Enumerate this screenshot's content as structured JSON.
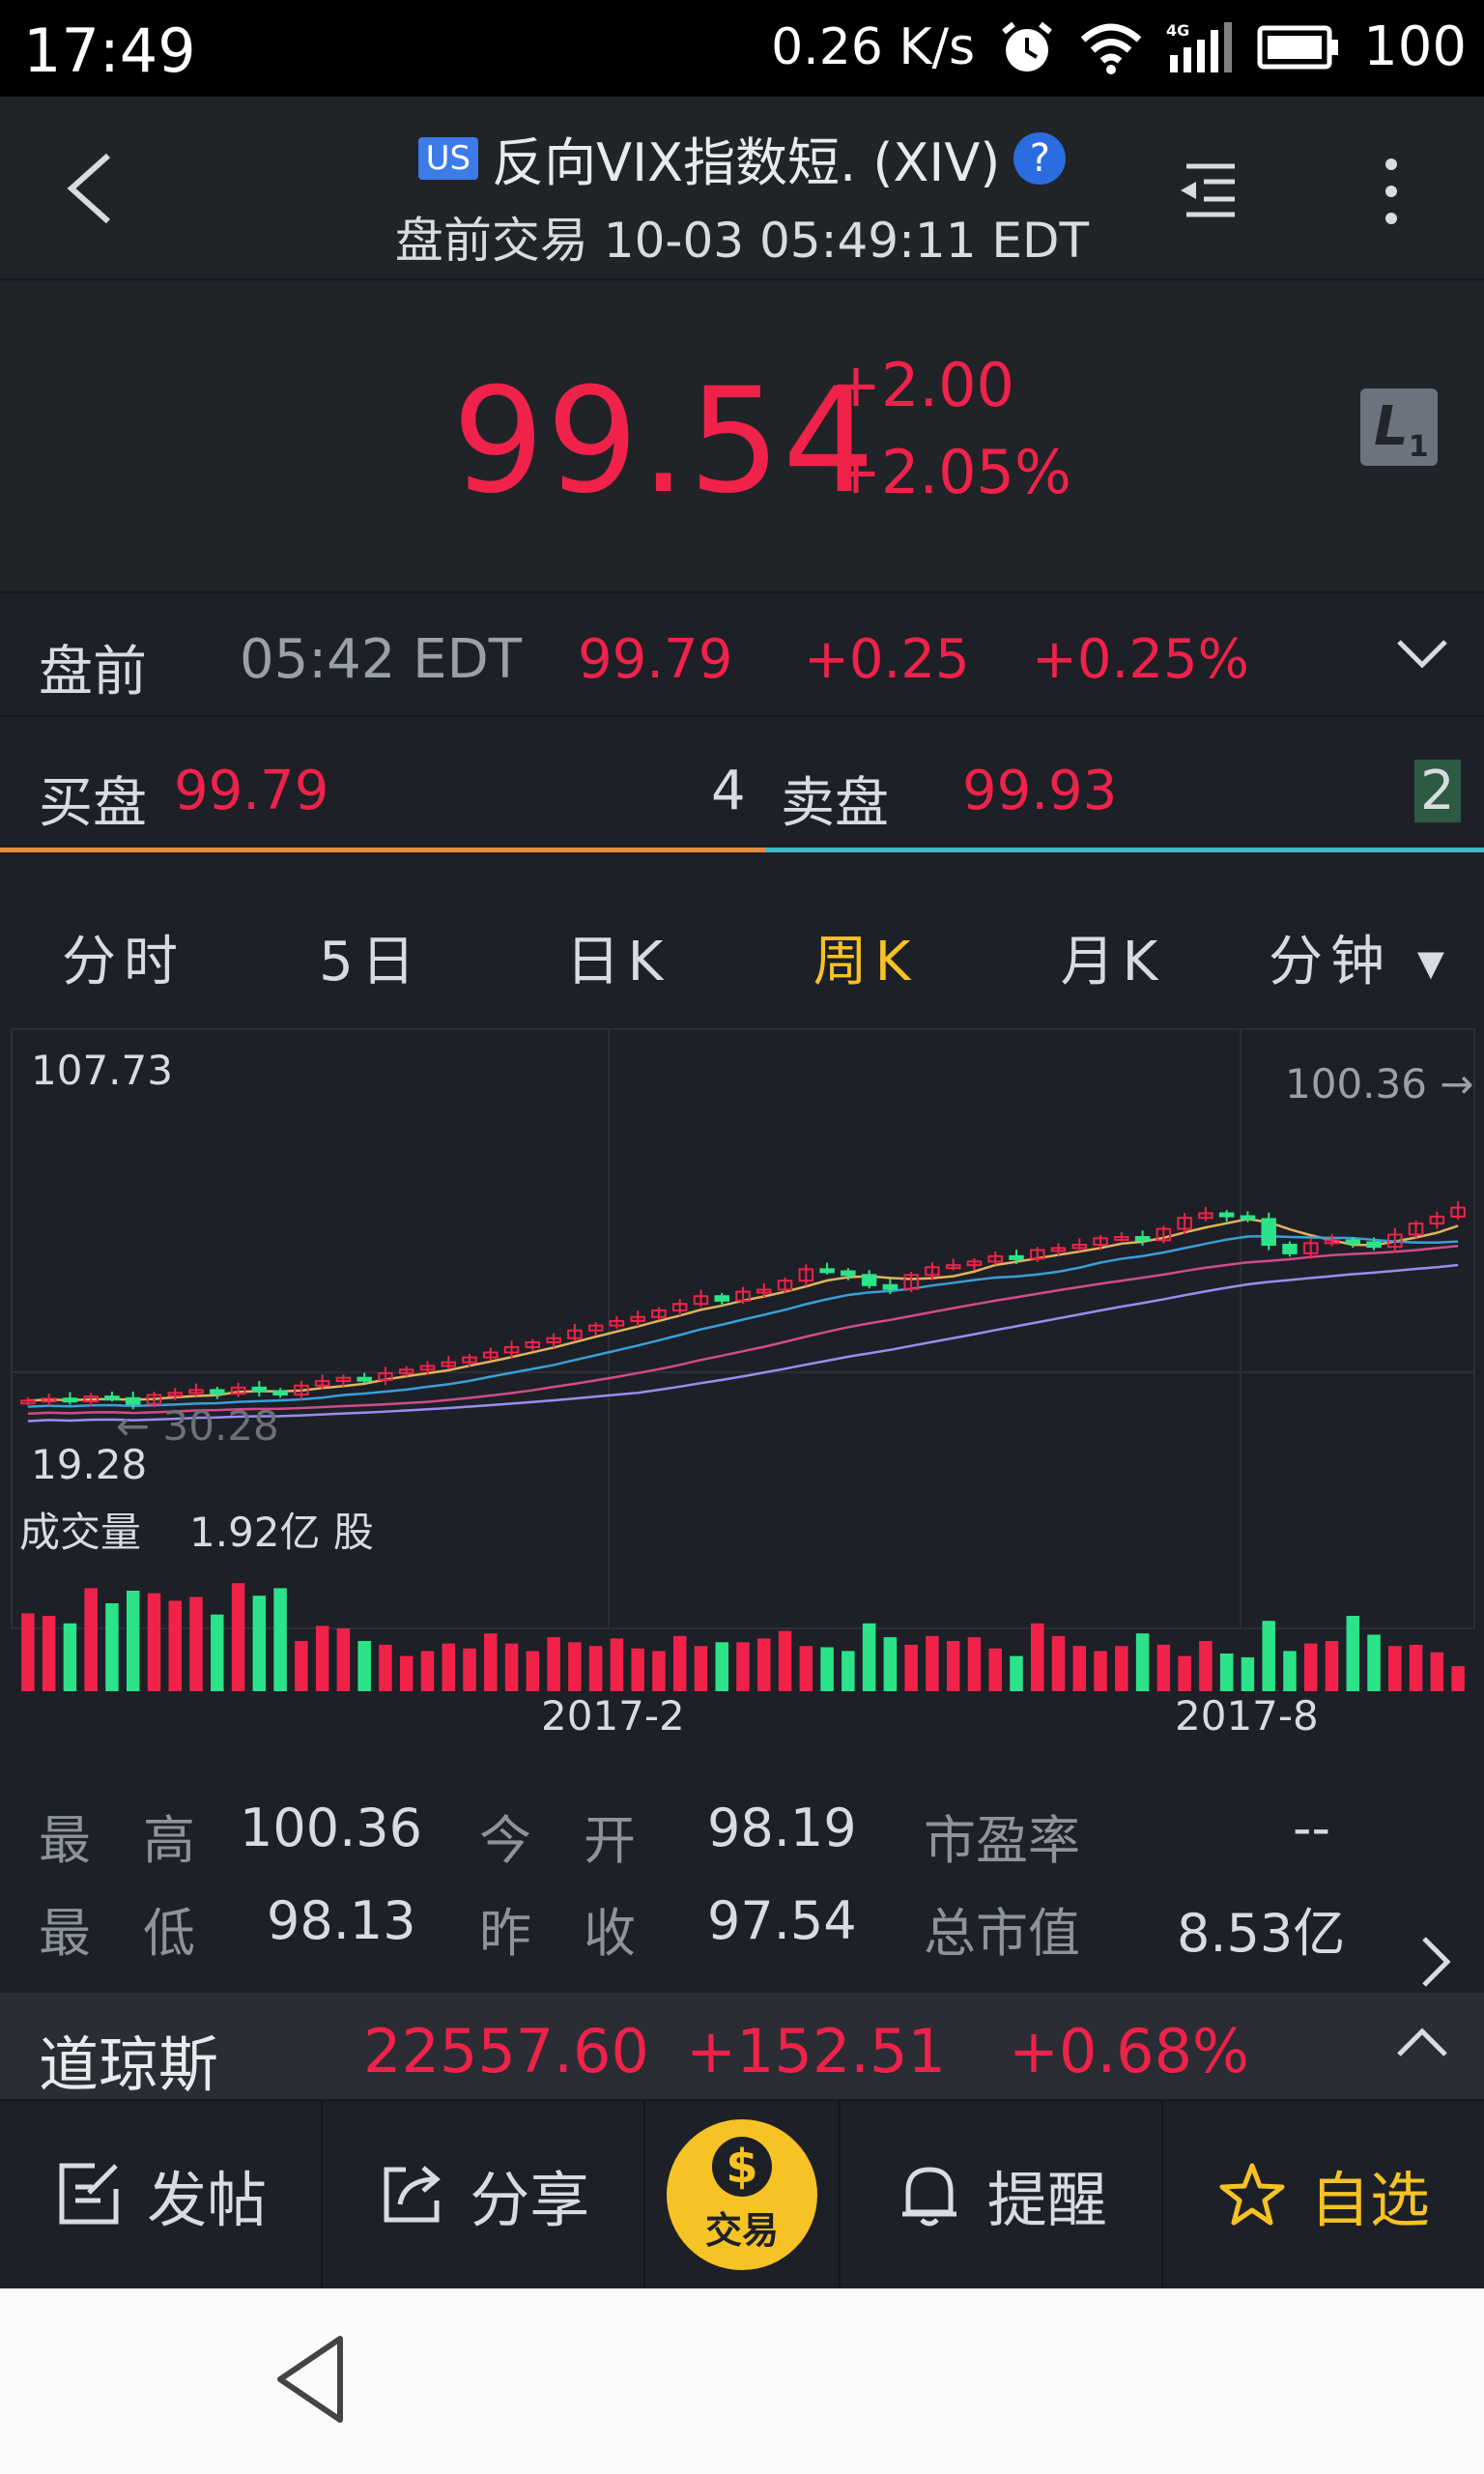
{
  "status_bar": {
    "time": "17:49",
    "speed": "0.26 K/s",
    "network": "4G",
    "battery": "100",
    "icons": [
      "alarm-icon",
      "wifi-icon",
      "signal-icon",
      "battery-icon"
    ]
  },
  "header": {
    "market_badge": "US",
    "title": "反向VIX指数短. (XIV)",
    "help": "?",
    "subtitle": "盘前交易 10-03 05:49:11 EDT"
  },
  "quote": {
    "price": "99.54",
    "change": "+2.00",
    "change_pct": "+2.05%",
    "level": "L",
    "level_sub": "1"
  },
  "premarket": {
    "label": "盘前",
    "time": "05:42 EDT",
    "price": "99.79",
    "change": "+0.25",
    "change_pct": "+0.25%"
  },
  "bid_ask": {
    "bid_label": "买盘",
    "bid_price": "99.79",
    "bid_size": "4",
    "ask_label": "卖盘",
    "ask_price": "99.93",
    "ask_size": "2"
  },
  "tabs": [
    {
      "label": "分时"
    },
    {
      "label": "5日"
    },
    {
      "label": "日K"
    },
    {
      "label": "周K"
    },
    {
      "label": "月K"
    },
    {
      "label": "分钟 ▾"
    }
  ],
  "chart_labels": {
    "max_price": "107.73",
    "min_price": "19.28",
    "high_mark": "100.36 →",
    "low_mark": "← 30.28",
    "volume_label": "成交量",
    "volume_value": "1.92亿 股",
    "x_ticks": [
      "2017-2",
      "2017-8"
    ]
  },
  "chart_data": {
    "type": "candlestick",
    "interval": "weekly",
    "y_range": [
      19.28,
      107.73
    ],
    "x_ticks": [
      "2017-2",
      "2017-8"
    ],
    "close": [
      32,
      32.5,
      31.8,
      33,
      32.6,
      31.2,
      33.4,
      33.9,
      34.6,
      33.7,
      35.2,
      34.3,
      33.5,
      35.7,
      36.8,
      37.6,
      37.1,
      38.7,
      39.6,
      40.5,
      41.4,
      42.6,
      43.8,
      45.1,
      46.3,
      47.3,
      49.2,
      50.4,
      51.5,
      52.5,
      54.1,
      55.7,
      57.6,
      56.5,
      58.7,
      59.2,
      61.4,
      64.2,
      63.7,
      62.8,
      60.3,
      59.4,
      62.8,
      64.7,
      65.2,
      66.1,
      67.4,
      66.8,
      68.9,
      69.4,
      70.2,
      71.8,
      72.1,
      71.3,
      74.1,
      76.8,
      77.9,
      77.2,
      76.5,
      70.2,
      68.1,
      70.6,
      71.3,
      70.8,
      69.7,
      72.7,
      75.4,
      77.1,
      79.3
    ],
    "volume_norm": [
      0.62,
      0.6,
      0.54,
      0.82,
      0.7,
      0.8,
      0.78,
      0.72,
      0.75,
      0.61,
      0.86,
      0.76,
      0.82,
      0.4,
      0.52,
      0.5,
      0.4,
      0.37,
      0.28,
      0.32,
      0.38,
      0.34,
      0.46,
      0.38,
      0.32,
      0.43,
      0.39,
      0.36,
      0.42,
      0.34,
      0.32,
      0.44,
      0.36,
      0.39,
      0.39,
      0.42,
      0.48,
      0.36,
      0.35,
      0.32,
      0.54,
      0.43,
      0.37,
      0.44,
      0.4,
      0.43,
      0.34,
      0.28,
      0.54,
      0.44,
      0.36,
      0.32,
      0.36,
      0.46,
      0.37,
      0.28,
      0.4,
      0.3,
      0.27,
      0.56,
      0.32,
      0.38,
      0.4,
      0.6,
      0.45,
      0.36,
      0.37,
      0.31,
      0.2
    ]
  },
  "stats": [
    {
      "label": "最　高",
      "value": "100.36"
    },
    {
      "label": "今　开",
      "value": "98.19"
    },
    {
      "label": "市盈率",
      "value": "--"
    },
    {
      "label": "最　低",
      "value": "98.13"
    },
    {
      "label": "昨　收",
      "value": "97.54"
    },
    {
      "label": "总市值",
      "value": "8.53亿"
    }
  ],
  "index_strip": {
    "name": "道琼斯",
    "value": "22557.60",
    "change": "+152.51",
    "change_pct": "+0.68%"
  },
  "toolbar": {
    "post": "发帖",
    "share": "分享",
    "trade": "交易",
    "trade_symbol": "$",
    "alert": "提醒",
    "watch": "自选"
  },
  "colors": {
    "up": "#f0224a",
    "down": "#2be489",
    "accent": "#f6c225",
    "background": "#1d2026"
  }
}
